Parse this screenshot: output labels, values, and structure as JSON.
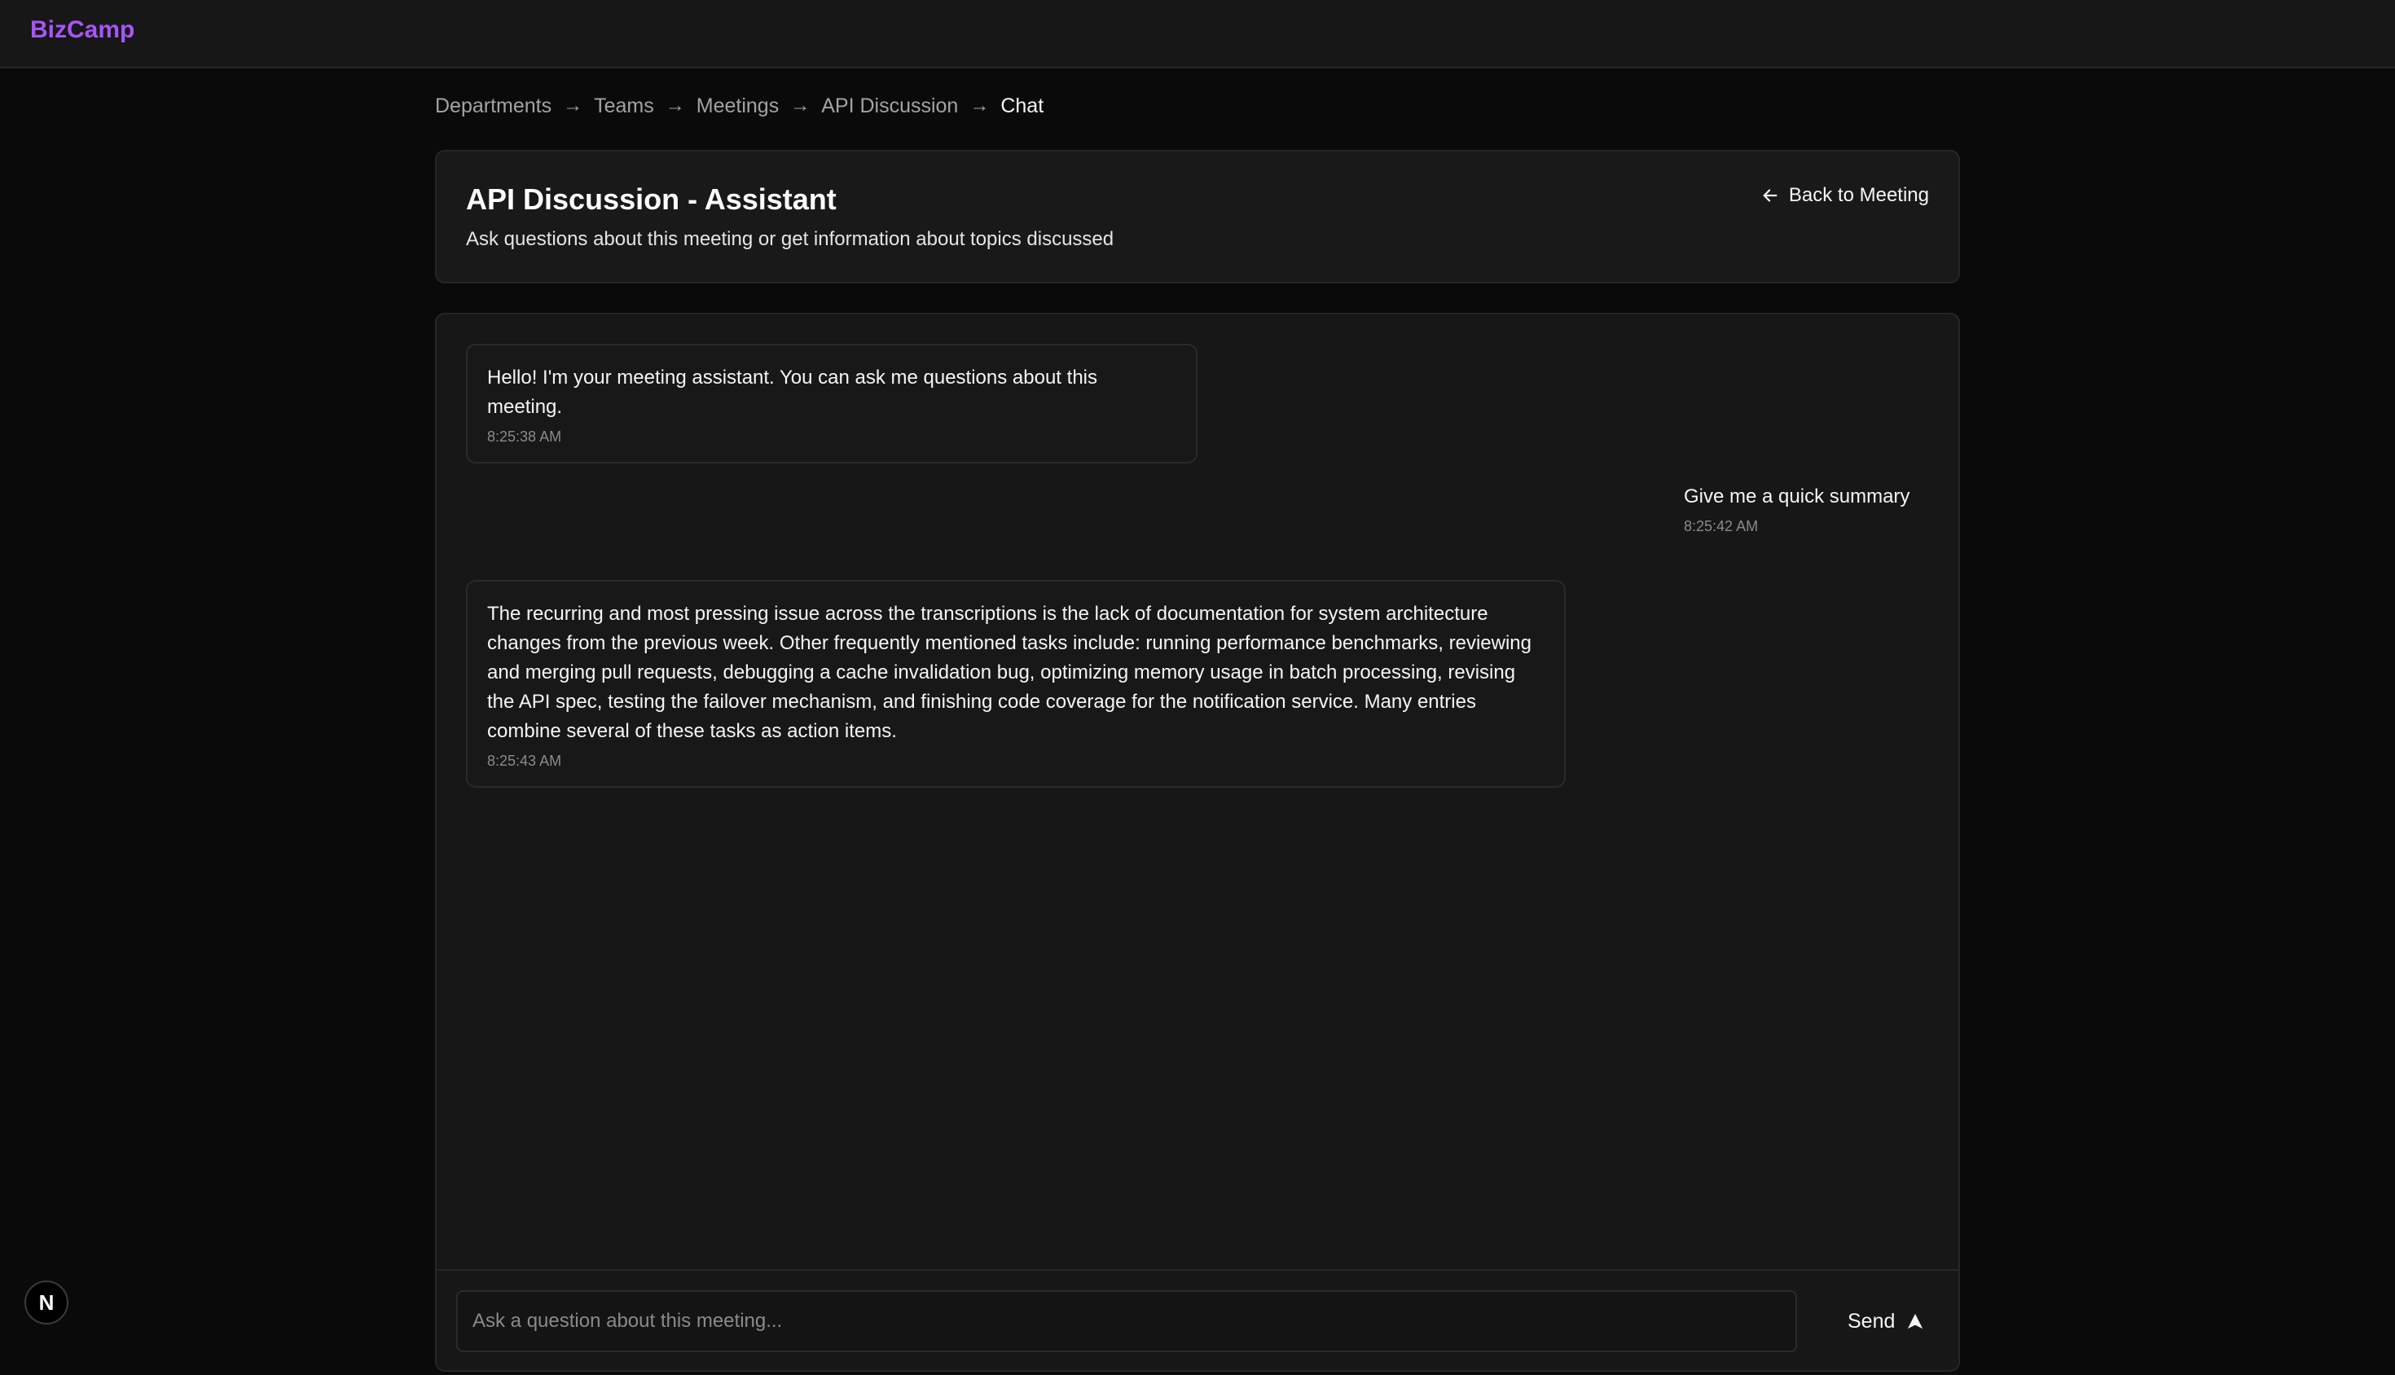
{
  "app": {
    "brand": "BizCamp"
  },
  "breadcrumb": {
    "items": [
      "Departments",
      "Teams",
      "Meetings",
      "API Discussion",
      "Chat"
    ],
    "separator": "→"
  },
  "header": {
    "title": "API Discussion - Assistant",
    "subtitle": "Ask questions about this meeting or get information about topics discussed",
    "back_label": "Back to Meeting"
  },
  "messages": [
    {
      "role": "assistant",
      "text": "Hello! I'm your meeting assistant. You can ask me questions about this meeting.",
      "time": "8:25:38 AM"
    },
    {
      "role": "user",
      "text": "Give me a quick summary",
      "time": "8:25:42 AM"
    },
    {
      "role": "assistant",
      "text": "The recurring and most pressing issue across the transcriptions is the lack of documentation for system architecture changes from the previous week. Other frequently mentioned tasks include: running performance benchmarks, reviewing and merging pull requests, debugging a cache invalidation bug, optimizing memory usage in batch processing, revising the API spec, testing the failover mechanism, and finishing code coverage for the notification service. Many entries combine several of these tasks as action items.",
      "time": "8:25:43 AM"
    }
  ],
  "composer": {
    "placeholder": "Ask a question about this meeting...",
    "value": "",
    "send_label": "Send"
  },
  "dev_badge": {
    "label": "N"
  },
  "colors": {
    "brand": "#a855f7",
    "background": "#0a0a0a",
    "panel": "#171717",
    "border": "#262626"
  }
}
